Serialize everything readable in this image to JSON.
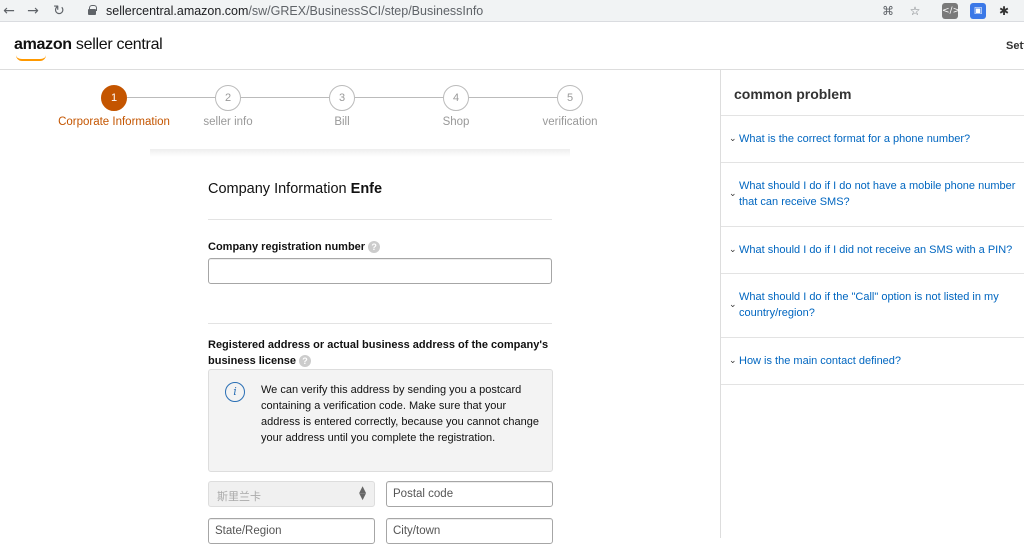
{
  "browser": {
    "url_host": "sellercentral.amazon.com",
    "url_path": "/sw/GREX/BusinessSCI/step/BusinessInfo",
    "icons": [
      "back-icon",
      "forward-icon",
      "reload-icon",
      "lock-icon",
      "translate-icon",
      "star-icon",
      "extension-code-icon",
      "extension-blue-icon",
      "puzzle-icon"
    ]
  },
  "header": {
    "logo_brand": "amazon",
    "logo_product": " seller central",
    "settings_label": "Settings"
  },
  "stepper": {
    "steps": [
      {
        "number": "1",
        "label": "Corporate Information",
        "active": true
      },
      {
        "number": "2",
        "label": "seller info",
        "active": false
      },
      {
        "number": "3",
        "label": "Bill",
        "active": false
      },
      {
        "number": "4",
        "label": "Shop",
        "active": false
      },
      {
        "number": "5",
        "label": "verification",
        "active": false
      }
    ],
    "active_color": "#c45500"
  },
  "form": {
    "title_prefix": "Company Information ",
    "title_name": "Enfe",
    "reg_number_label": "Company registration number",
    "reg_number_value": "",
    "address_label": "Registered address or actual business address of the company's business license",
    "info_icon": "i",
    "info_text": "We can verify this address by sending you a postcard containing a verification code. Make sure that your address is entered correctly, because you cannot change your address until you complete the registration.",
    "country_value": "斯里兰卡",
    "postal_placeholder": "Postal code",
    "state_placeholder": "State/Region",
    "city_placeholder": "City/town"
  },
  "side": {
    "title": "common problem",
    "faqs": [
      "What is the correct format for a phone number?",
      "What should I do if I do not have a mobile phone number that can receive SMS?",
      "What should I do if I did not receive an SMS with a PIN?",
      "What should I do if the \"Call\" option is not listed in my country/region?",
      "How is the main contact defined?"
    ],
    "link_color": "#0066c0"
  }
}
